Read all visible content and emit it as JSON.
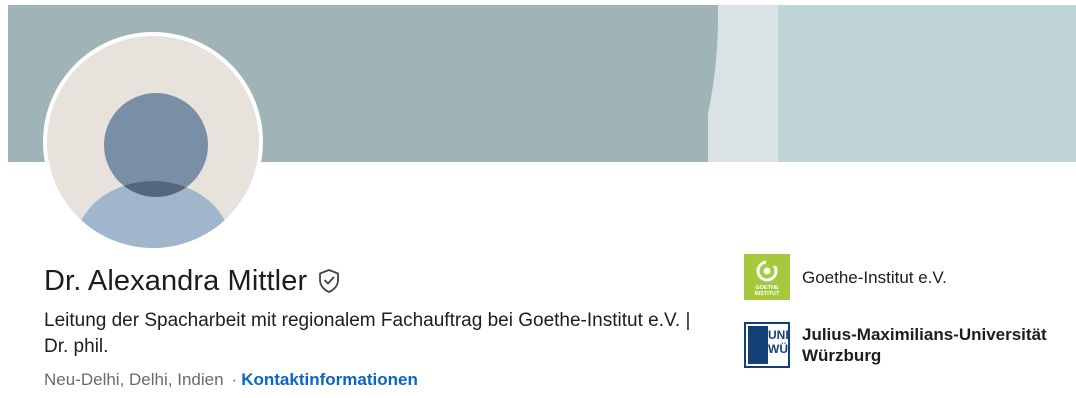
{
  "profile": {
    "name": "Dr. Alexandra Mittler",
    "headline": "Leitung der Spacharbeit mit regionalem Fachauftrag bei Goethe-Institut e.V. | Dr. phil.",
    "location": "Neu-Delhi, Delhi, Indien",
    "separator": "·",
    "contact_link": "Kontaktinformationen"
  },
  "organizations": [
    {
      "name": "Goethe-Institut e.V.",
      "icon": "goethe-institut-logo"
    },
    {
      "name": "Julius-Maximilians-Universität Würzburg",
      "icon": "jmu-wuerzburg-logo"
    }
  ],
  "logo_text": {
    "goethe": "GOETHE INSTITUT",
    "wue_top": "UNI",
    "wue_bottom": "WÜ"
  },
  "colors": {
    "banner": "#a0b4b7",
    "link": "#0a66c2",
    "goethe_green": "#a6c83d",
    "jmu_blue": "#14407a"
  }
}
